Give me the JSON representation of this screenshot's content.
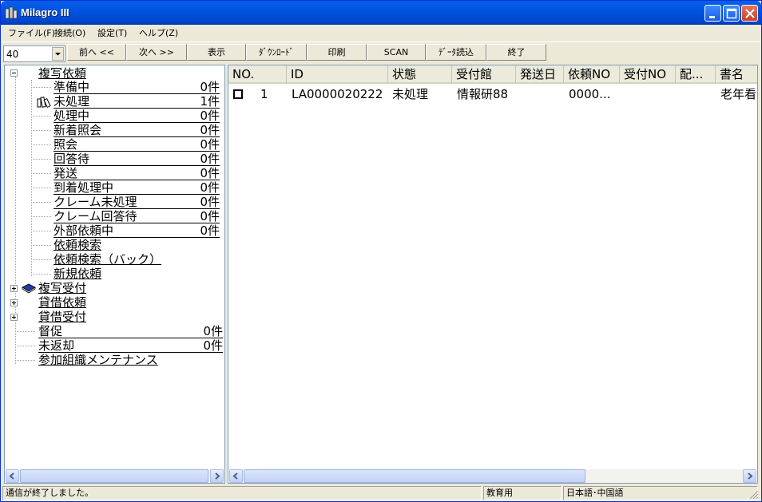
{
  "window": {
    "title": "Milagro III"
  },
  "menu": [
    {
      "label": "ファイル(F)"
    },
    {
      "label": "接続(O)"
    },
    {
      "label": "設定(T)"
    },
    {
      "label": "ヘルプ(Z)"
    }
  ],
  "toolbar": {
    "count_value": "40",
    "buttons": [
      {
        "label": "前へ <<"
      },
      {
        "label": "次へ >>"
      },
      {
        "label": "表示"
      },
      {
        "label": "ﾀﾞｳﾝﾛｰﾄﾞ"
      },
      {
        "label": "印刷"
      },
      {
        "label": "SCAN"
      },
      {
        "label": "ﾃﾞｰﾀ読込"
      },
      {
        "label": "終了"
      }
    ]
  },
  "tree": {
    "root1": {
      "label": "複写依頼"
    },
    "root1_items": [
      {
        "label": "準備中",
        "count": "0件"
      },
      {
        "label": "未処理",
        "count": "1件"
      },
      {
        "label": "処理中",
        "count": "0件"
      },
      {
        "label": "新着照会",
        "count": "0件"
      },
      {
        "label": "照会",
        "count": "0件"
      },
      {
        "label": "回答待",
        "count": "0件"
      },
      {
        "label": "発送",
        "count": "0件"
      },
      {
        "label": "到着処理中",
        "count": "0件"
      },
      {
        "label": "クレーム未処理",
        "count": "0件"
      },
      {
        "label": "クレーム回答待",
        "count": "0件"
      },
      {
        "label": "外部依頼中",
        "count": "0件"
      }
    ],
    "root1_links": [
      {
        "label": "依頼検索"
      },
      {
        "label": "依頼検索（バック）"
      },
      {
        "label": "新規依頼"
      }
    ],
    "roots": [
      {
        "label": "複写受付"
      },
      {
        "label": "貸借依頼"
      },
      {
        "label": "貸借受付"
      }
    ],
    "bottom_items": [
      {
        "label": "督促",
        "count": "0件"
      },
      {
        "label": "未返却",
        "count": "0件"
      }
    ],
    "bottom_link": {
      "label": "参加組織メンテナンス"
    }
  },
  "list": {
    "columns": [
      {
        "label": "NO."
      },
      {
        "label": "ID"
      },
      {
        "label": "状態"
      },
      {
        "label": "受付館"
      },
      {
        "label": "発送日"
      },
      {
        "label": "依頼NO"
      },
      {
        "label": "受付NO"
      },
      {
        "label": "配..."
      },
      {
        "label": "書名"
      }
    ],
    "rows": [
      {
        "no": "1",
        "id": "LA0000020222",
        "status": "未処理",
        "library": "情報研88",
        "ship_date": "",
        "request_no": "0000...",
        "receipt_no": "",
        "delivery": "",
        "title": "老年看"
      }
    ]
  },
  "status": {
    "message": "通信が終了しました。",
    "mode": "教育用",
    "language": "日本語･中国語"
  },
  "colors": {
    "titlebar": "#0054e3",
    "window_bg": "#ece9d8",
    "pane_border": "#7f9db9"
  }
}
